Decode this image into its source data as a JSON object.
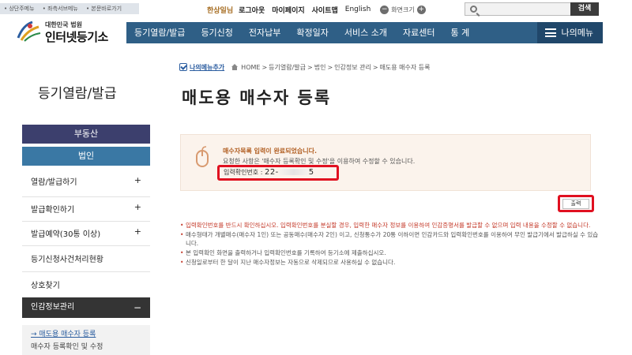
{
  "skip_links": [
    "상단주메뉴",
    "좌측서브메뉴",
    "본문바로가기"
  ],
  "utility": {
    "user_name": "한상일님",
    "logout": "로그아웃",
    "mypage": "마이페이지",
    "sitemap": "사이트맵",
    "english": "English",
    "zoom_label": "화면크기"
  },
  "search": {
    "placeholder": "",
    "button": "검색"
  },
  "logo": {
    "sub": "대한민국 법원",
    "main": "인터넷등기소"
  },
  "gnb": {
    "items": [
      "등기열람/발급",
      "등기신청",
      "전자납부",
      "확정일자",
      "서비스 소개",
      "자료센터",
      "통 계"
    ],
    "my_menu": "나의메뉴"
  },
  "sidebar": {
    "title": "등기열람/발급",
    "categories": [
      "부동산",
      "법인"
    ],
    "items": [
      {
        "label": "열람/발급하기",
        "expand": "+"
      },
      {
        "label": "발급확인하기",
        "expand": "+"
      },
      {
        "label": "발급예약(30통 이상)",
        "expand": "+"
      },
      {
        "label": "등기신청사건처리현황"
      },
      {
        "label": "상호찾기"
      },
      {
        "label": "인감정보관리",
        "expand": "−"
      }
    ],
    "submenu": [
      "→ 매도용 매수자 등록",
      "매수자 등록확인 및 수정"
    ]
  },
  "breadcrumb": {
    "my_menu_add": "나의메뉴추가",
    "path": [
      "HOME",
      "등기열람/발급",
      "법인",
      "인감정보 관리",
      "매도용 매수자 등록"
    ]
  },
  "page_title": "매도용 매수자 등록",
  "notice": {
    "line1": "매수자목록 입력이 완료되었습니다.",
    "line2": "요청한 사항은 '매수자 등록확인 및 수정'을 이용하여 수정할 수 있습니다.",
    "ref_label": "입력확인번호 :",
    "ref_prefix": "22-",
    "ref_suffix": "5"
  },
  "print_button": "출력",
  "notes": [
    "입력확인번호를 반드시 확인하십시오. 입력확인번호를 분실할 경우, 입력한 매수자 정보를 이용하여 인감증명서를 발급할 수 없으며 입력 내용을 수정할 수 없습니다.",
    "매수형태가 개별매수(매수자 1인) 또는 공동매수(매수자 2인) 이고, 신청통수가 20통 이하이면 인감카드와 입력확인번호를 이용하여 무인 발급기에서 발급하실 수 있습니다.",
    "본 입력확인 화면을 출력하거나 입력확인번호를 기록하여 등기소에 제출하십시오.",
    "신청일로부터 한 달이 지난 매수자정보는 자동으로 삭제되므로 사용하실 수 없습니다."
  ],
  "colors": {
    "gnb": "#2f5f86",
    "sidebar_realty": "#3c3f6d",
    "sidebar_corp": "#3a78a4",
    "highlight": "#e01020"
  }
}
